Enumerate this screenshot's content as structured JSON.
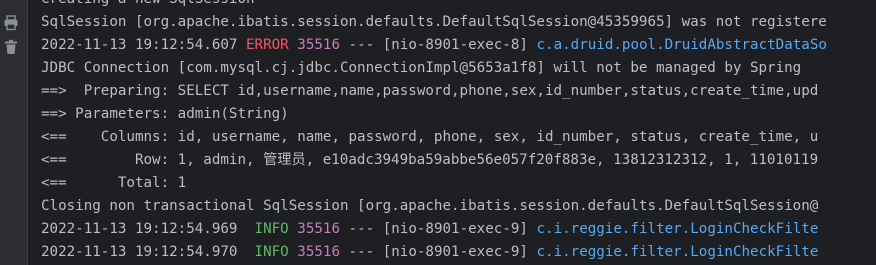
{
  "gutter": {
    "icons": [
      "print-icon",
      "trash-icon"
    ]
  },
  "console": {
    "lines": [
      {
        "text": "Creating a new SqlSession"
      },
      {
        "text": "SqlSession [org.apache.ibatis.session.defaults.DefaultSqlSession@45359965] was not registere"
      },
      {
        "timestamp": "2022-11-13 19:12:54.607",
        "level": "ERROR",
        "pid": "35516",
        "sep": "---",
        "thread": "[nio-8901-exec-8]",
        "logger": "c.a.druid.pool.DruidAbstractDataSo"
      },
      {
        "text": "JDBC Connection [com.mysql.cj.jdbc.ConnectionImpl@5653a1f8] will not be managed by Spring"
      },
      {
        "text": "==>  Preparing: SELECT id,username,name,password,phone,sex,id_number,status,create_time,upd"
      },
      {
        "text": "==> Parameters: admin(String)"
      },
      {
        "text": "<==    Columns: id, username, name, password, phone, sex, id_number, status, create_time, u"
      },
      {
        "text": "<==        Row: 1, admin, 管理员, e10adc3949ba59abbe56e057f20f883e, 13812312312, 1, 11010119"
      },
      {
        "text": "<==      Total: 1"
      },
      {
        "text": "Closing non transactional SqlSession [org.apache.ibatis.session.defaults.DefaultSqlSession@"
      },
      {
        "timestamp": "2022-11-13 19:12:54.969",
        "level": " INFO",
        "pid": "35516",
        "sep": "---",
        "thread": "[nio-8901-exec-9]",
        "logger": "c.i.reggie.filter.LoginCheckFilte"
      },
      {
        "timestamp": "2022-11-13 19:12:54.970",
        "level": " INFO",
        "pid": "35516",
        "sep": "---",
        "thread": "[nio-8901-exec-9]",
        "logger": "c.i.reggie.filter.LoginCheckFilte"
      }
    ]
  }
}
